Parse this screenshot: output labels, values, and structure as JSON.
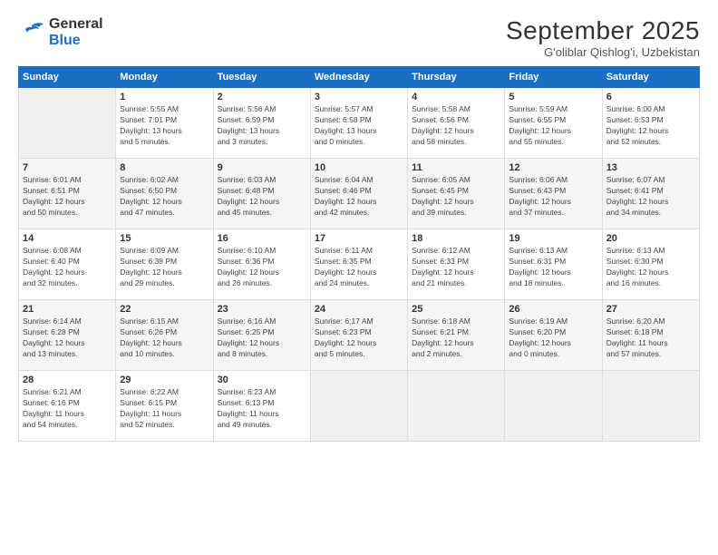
{
  "header": {
    "logo_line1": "General",
    "logo_line2": "Blue",
    "month": "September 2025",
    "location": "G'oliblar Qishlog'i, Uzbekistan"
  },
  "days_of_week": [
    "Sunday",
    "Monday",
    "Tuesday",
    "Wednesday",
    "Thursday",
    "Friday",
    "Saturday"
  ],
  "weeks": [
    [
      {
        "day": "",
        "info": ""
      },
      {
        "day": "1",
        "info": "Sunrise: 5:55 AM\nSunset: 7:01 PM\nDaylight: 13 hours\nand 5 minutes."
      },
      {
        "day": "2",
        "info": "Sunrise: 5:56 AM\nSunset: 6:59 PM\nDaylight: 13 hours\nand 3 minutes."
      },
      {
        "day": "3",
        "info": "Sunrise: 5:57 AM\nSunset: 6:58 PM\nDaylight: 13 hours\nand 0 minutes."
      },
      {
        "day": "4",
        "info": "Sunrise: 5:58 AM\nSunset: 6:56 PM\nDaylight: 12 hours\nand 58 minutes."
      },
      {
        "day": "5",
        "info": "Sunrise: 5:59 AM\nSunset: 6:55 PM\nDaylight: 12 hours\nand 55 minutes."
      },
      {
        "day": "6",
        "info": "Sunrise: 6:00 AM\nSunset: 6:53 PM\nDaylight: 12 hours\nand 52 minutes."
      }
    ],
    [
      {
        "day": "7",
        "info": "Sunrise: 6:01 AM\nSunset: 6:51 PM\nDaylight: 12 hours\nand 50 minutes."
      },
      {
        "day": "8",
        "info": "Sunrise: 6:02 AM\nSunset: 6:50 PM\nDaylight: 12 hours\nand 47 minutes."
      },
      {
        "day": "9",
        "info": "Sunrise: 6:03 AM\nSunset: 6:48 PM\nDaylight: 12 hours\nand 45 minutes."
      },
      {
        "day": "10",
        "info": "Sunrise: 6:04 AM\nSunset: 6:46 PM\nDaylight: 12 hours\nand 42 minutes."
      },
      {
        "day": "11",
        "info": "Sunrise: 6:05 AM\nSunset: 6:45 PM\nDaylight: 12 hours\nand 39 minutes."
      },
      {
        "day": "12",
        "info": "Sunrise: 6:06 AM\nSunset: 6:43 PM\nDaylight: 12 hours\nand 37 minutes."
      },
      {
        "day": "13",
        "info": "Sunrise: 6:07 AM\nSunset: 6:41 PM\nDaylight: 12 hours\nand 34 minutes."
      }
    ],
    [
      {
        "day": "14",
        "info": "Sunrise: 6:08 AM\nSunset: 6:40 PM\nDaylight: 12 hours\nand 32 minutes."
      },
      {
        "day": "15",
        "info": "Sunrise: 6:09 AM\nSunset: 6:38 PM\nDaylight: 12 hours\nand 29 minutes."
      },
      {
        "day": "16",
        "info": "Sunrise: 6:10 AM\nSunset: 6:36 PM\nDaylight: 12 hours\nand 26 minutes."
      },
      {
        "day": "17",
        "info": "Sunrise: 6:11 AM\nSunset: 6:35 PM\nDaylight: 12 hours\nand 24 minutes."
      },
      {
        "day": "18",
        "info": "Sunrise: 6:12 AM\nSunset: 6:33 PM\nDaylight: 12 hours\nand 21 minutes."
      },
      {
        "day": "19",
        "info": "Sunrise: 6:13 AM\nSunset: 6:31 PM\nDaylight: 12 hours\nand 18 minutes."
      },
      {
        "day": "20",
        "info": "Sunrise: 6:13 AM\nSunset: 6:30 PM\nDaylight: 12 hours\nand 16 minutes."
      }
    ],
    [
      {
        "day": "21",
        "info": "Sunrise: 6:14 AM\nSunset: 6:28 PM\nDaylight: 12 hours\nand 13 minutes."
      },
      {
        "day": "22",
        "info": "Sunrise: 6:15 AM\nSunset: 6:26 PM\nDaylight: 12 hours\nand 10 minutes."
      },
      {
        "day": "23",
        "info": "Sunrise: 6:16 AM\nSunset: 6:25 PM\nDaylight: 12 hours\nand 8 minutes."
      },
      {
        "day": "24",
        "info": "Sunrise: 6:17 AM\nSunset: 6:23 PM\nDaylight: 12 hours\nand 5 minutes."
      },
      {
        "day": "25",
        "info": "Sunrise: 6:18 AM\nSunset: 6:21 PM\nDaylight: 12 hours\nand 2 minutes."
      },
      {
        "day": "26",
        "info": "Sunrise: 6:19 AM\nSunset: 6:20 PM\nDaylight: 12 hours\nand 0 minutes."
      },
      {
        "day": "27",
        "info": "Sunrise: 6:20 AM\nSunset: 6:18 PM\nDaylight: 11 hours\nand 57 minutes."
      }
    ],
    [
      {
        "day": "28",
        "info": "Sunrise: 6:21 AM\nSunset: 6:16 PM\nDaylight: 11 hours\nand 54 minutes."
      },
      {
        "day": "29",
        "info": "Sunrise: 6:22 AM\nSunset: 6:15 PM\nDaylight: 11 hours\nand 52 minutes."
      },
      {
        "day": "30",
        "info": "Sunrise: 6:23 AM\nSunset: 6:13 PM\nDaylight: 11 hours\nand 49 minutes."
      },
      {
        "day": "",
        "info": ""
      },
      {
        "day": "",
        "info": ""
      },
      {
        "day": "",
        "info": ""
      },
      {
        "day": "",
        "info": ""
      }
    ]
  ]
}
